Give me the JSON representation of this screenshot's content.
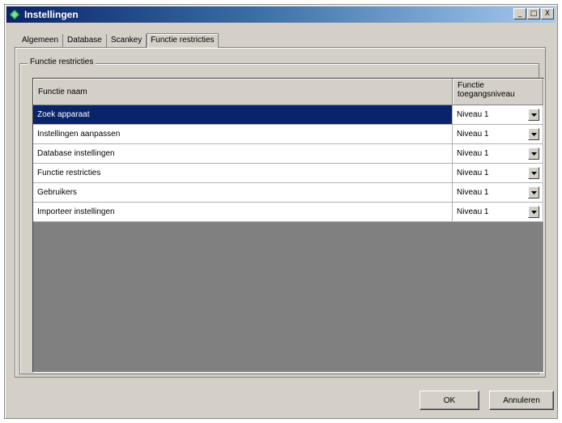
{
  "window": {
    "title": "Instellingen",
    "minimize_label": "_",
    "maximize_label": "□",
    "close_label": "X"
  },
  "tabs": [
    {
      "label": "Algemeen"
    },
    {
      "label": "Database"
    },
    {
      "label": "Scankey"
    },
    {
      "label": "Functie restricties",
      "active": true
    }
  ],
  "group": {
    "legend": "Functie restricties"
  },
  "grid": {
    "columns": {
      "name": "Functie naam",
      "level_line1": "Functie",
      "level_line2": "toegangsniveau"
    },
    "rows": [
      {
        "name": "Zoek apparaat",
        "level": "Niveau 1",
        "selected": true
      },
      {
        "name": "Instellingen aanpassen",
        "level": "Niveau 1"
      },
      {
        "name": "Database instellingen",
        "level": "Niveau 1"
      },
      {
        "name": "Functie restricties",
        "level": "Niveau 1"
      },
      {
        "name": "Gebruikers",
        "level": "Niveau 1"
      },
      {
        "name": "Importeer instellingen",
        "level": "Niveau 1"
      }
    ]
  },
  "buttons": {
    "ok": "OK",
    "cancel": "Annuleren"
  },
  "colors": {
    "titlebar_start": "#0a246a",
    "titlebar_end": "#a6caf0",
    "selection": "#0a246a",
    "grid_background": "#808080",
    "dialog_face": "#d4d0c8",
    "app_icon": "#3cb54a"
  },
  "icons": {
    "app": "green-diamond-icon",
    "dropdown": "chevron-down-icon"
  }
}
